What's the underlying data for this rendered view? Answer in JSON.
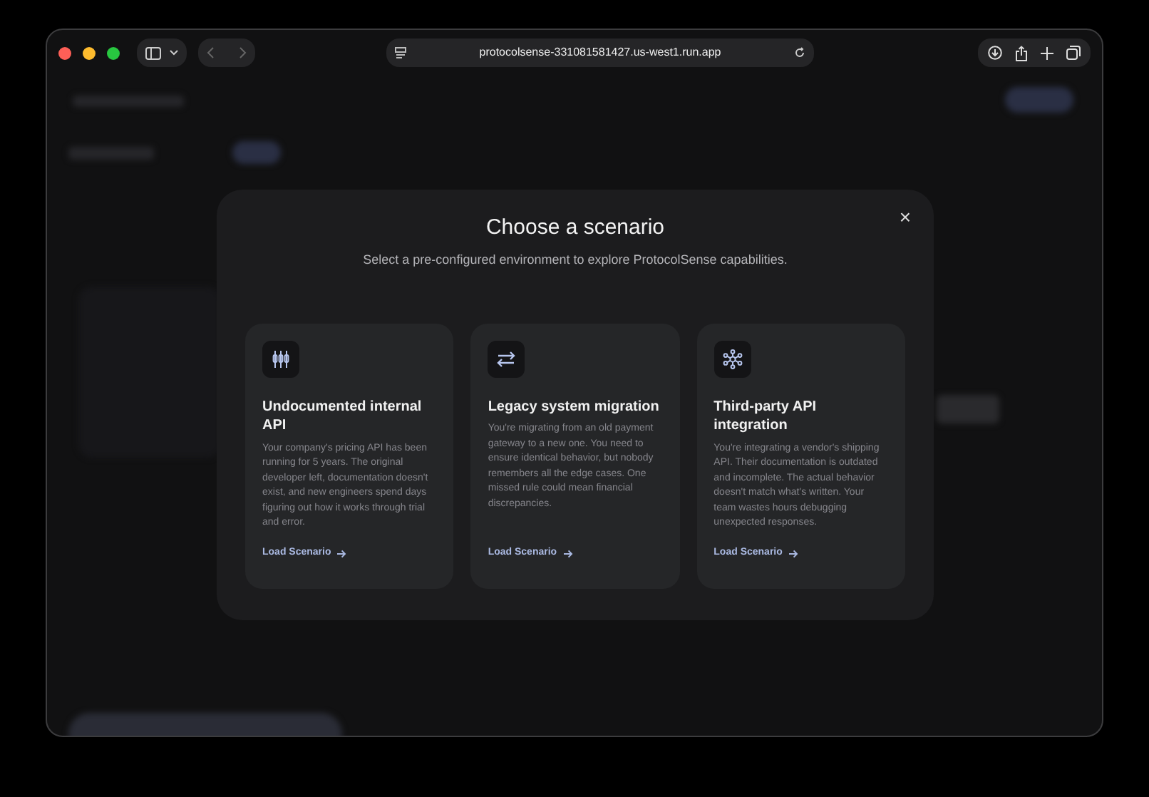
{
  "browser": {
    "url": "protocolsense-331081581427.us-west1.run.app",
    "sidebar_open": false
  },
  "modal": {
    "title": "Choose a scenario",
    "subtitle": "Select a pre-configured environment to explore ProtocolSense capabilities.",
    "close": "×",
    "scenarios": [
      {
        "kind": "columns",
        "title": "Undocumented internal API",
        "description": "Your company's pricing API has been running for 5 years. The original developer left, documentation doesn't exist, and new engineers spend days figuring out how it works through trial and error.",
        "action": "Load Scenario"
      },
      {
        "kind": "swap",
        "title": "Legacy system migration",
        "description": "You're migrating from an old payment gateway to a new one. You need to ensure identical behavior, but nobody remembers all the edge cases. One missed rule could mean financial discrepancies.",
        "action": "Load Scenario"
      },
      {
        "kind": "network",
        "title": "Third-party API integration",
        "description": "You're integrating a vendor's shipping API. Their documentation is outdated and incomplete. The actual behavior doesn't match what's written. Your team wastes hours debugging unexpected responses.",
        "action": "Load Scenario"
      }
    ]
  }
}
